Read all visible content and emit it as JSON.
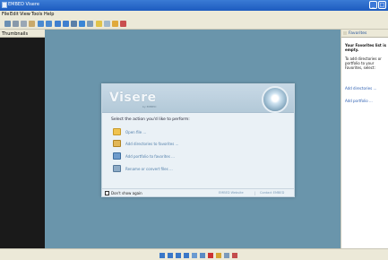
{
  "window": {
    "title": "EMBED Visere"
  },
  "menu": [
    "File",
    "Edit",
    "View",
    "Tools",
    "Help"
  ],
  "toolbar_icons": [
    "back-icon",
    "cut-icon",
    "copy-icon",
    "paste-icon",
    "rotate-left-icon",
    "rotate-right-icon",
    "prev-icon",
    "next-icon",
    "edit-icon",
    "slideshow-icon",
    "fullscreen-icon",
    "zoom-in-icon",
    "zoom-out-icon",
    "properties-icon",
    "favorite-icon"
  ],
  "thumbnails": {
    "header": "Thumbnails"
  },
  "dialog": {
    "logo": "Visere",
    "logo_sub": "by EMBED",
    "prompt": "Select the action you'd like to perform:",
    "actions": [
      {
        "label": "Open file ...",
        "icon": "folder-icon"
      },
      {
        "label": "Add directories to favorites ...",
        "icon": "folder-add-icon"
      },
      {
        "label": "Add portfolio to favorites ...",
        "icon": "portfolio-icon"
      },
      {
        "label": "Rename or convert files ...",
        "icon": "rename-icon"
      }
    ],
    "dont_show": "Don't show again",
    "link_website": "EMBED Website",
    "link_contact": "Contact EMBED",
    "separator": "|"
  },
  "favorites": {
    "header": "Favorites",
    "empty_title": "Your Favorites list is empty.",
    "empty_body": "To add directories or portfolio to your Favorites, select:",
    "link_dirs": "Add directories ...",
    "link_portfolio": "Add portfolio ..."
  },
  "bottom_icons": [
    "first-icon",
    "prev-icon",
    "play-icon",
    "next-icon",
    "zoom-icon",
    "rotate-icon",
    "delete-icon",
    "settings-icon",
    "info-icon",
    "export-icon"
  ]
}
